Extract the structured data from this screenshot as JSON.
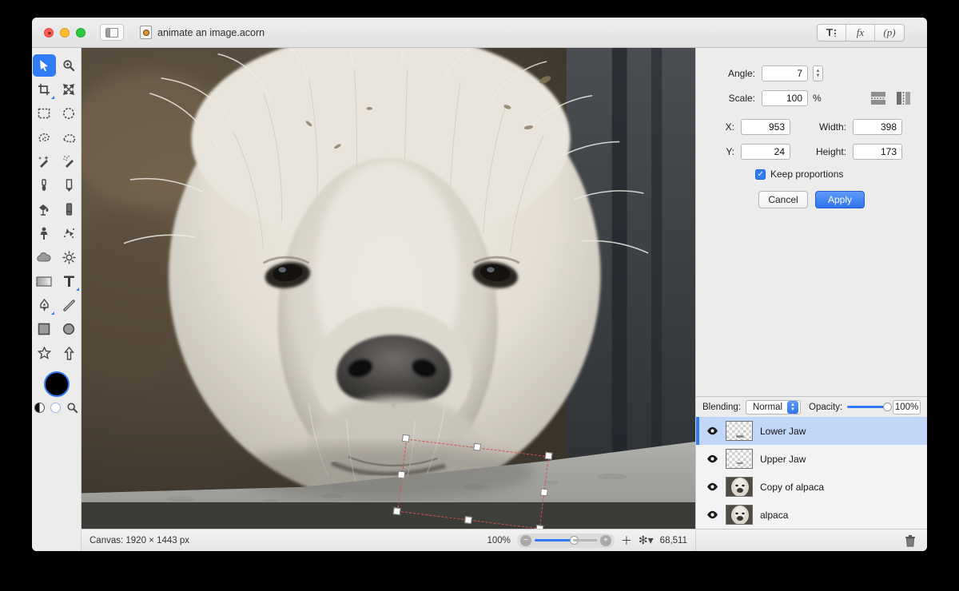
{
  "window": {
    "title": "animate an image.acorn",
    "traffic_lights": [
      "close",
      "minimize",
      "zoom"
    ]
  },
  "toolbar": {
    "sidebar_toggle": "sidebar-toggle",
    "segmented": [
      {
        "id": "transform",
        "label": ""
      },
      {
        "id": "fx",
        "label": "fx"
      },
      {
        "id": "p",
        "label": "(p)"
      }
    ]
  },
  "tools": [
    {
      "name": "move-tool",
      "selected": true
    },
    {
      "name": "zoom-tool",
      "selected": false
    },
    {
      "name": "crop-tool",
      "selected": false
    },
    {
      "name": "transform-tool",
      "selected": false
    },
    {
      "name": "rectangular-select-tool",
      "selected": false
    },
    {
      "name": "elliptical-select-tool",
      "selected": false
    },
    {
      "name": "lasso-tool",
      "selected": false
    },
    {
      "name": "polygon-lasso-tool",
      "selected": false
    },
    {
      "name": "magic-wand-tool",
      "selected": false
    },
    {
      "name": "instant-alpha-tool",
      "selected": false
    },
    {
      "name": "brush-tool",
      "selected": false
    },
    {
      "name": "pencil-tool",
      "selected": false
    },
    {
      "name": "paint-bucket-tool",
      "selected": false
    },
    {
      "name": "eraser-tool",
      "selected": false
    },
    {
      "name": "clone-stamp-tool",
      "selected": false
    },
    {
      "name": "smudge-tool",
      "selected": false
    },
    {
      "name": "blur-tool",
      "selected": false
    },
    {
      "name": "dodge-tool",
      "selected": false
    },
    {
      "name": "gradient-tool",
      "selected": false
    },
    {
      "name": "text-tool",
      "selected": false
    },
    {
      "name": "bezier-pen-tool",
      "selected": false
    },
    {
      "name": "line-tool",
      "selected": false
    },
    {
      "name": "rectangle-shape-tool",
      "selected": false
    },
    {
      "name": "ellipse-shape-tool",
      "selected": false
    },
    {
      "name": "star-shape-tool",
      "selected": false
    },
    {
      "name": "arrow-shape-tool",
      "selected": false
    }
  ],
  "transform_panel": {
    "angle_label": "Angle:",
    "angle_value": "7",
    "scale_label": "Scale:",
    "scale_value": "100",
    "scale_unit": "%",
    "x_label": "X:",
    "x_value": "953",
    "y_label": "Y:",
    "y_value": "24",
    "width_label": "Width:",
    "width_value": "398",
    "height_label": "Height:",
    "height_value": "173",
    "keep_proportions_label": "Keep proportions",
    "keep_proportions_checked": true,
    "flip_horizontal": "flip-horizontal",
    "flip_vertical": "flip-vertical",
    "cancel_label": "Cancel",
    "apply_label": "Apply"
  },
  "layers_panel": {
    "blending_label": "Blending:",
    "blending_value": "Normal",
    "opacity_label": "Opacity:",
    "opacity_value": "100%",
    "layers": [
      {
        "name": "Lower Jaw",
        "thumb": "transparent",
        "visible": true,
        "selected": true
      },
      {
        "name": "Upper Jaw",
        "thumb": "transparent",
        "visible": true,
        "selected": false
      },
      {
        "name": "Copy of alpaca",
        "thumb": "photo",
        "visible": true,
        "selected": false
      },
      {
        "name": "alpaca",
        "thumb": "photo",
        "visible": true,
        "selected": false
      }
    ],
    "delete_icon": "trash-icon"
  },
  "statusbar": {
    "canvas_info": "Canvas: 1920 × 1443 px",
    "zoom_level": "100%",
    "add_icon": "plus-icon",
    "settings_icon": "gear-icon",
    "memory_value": "68,511"
  },
  "canvas": {
    "image_subject": "alpaca",
    "selection": {
      "angle_deg": 7,
      "handles": 8
    }
  },
  "colors": {
    "accent": "#2f7cf6",
    "chrome": "#ececec",
    "selection_row": "#c2d6f7",
    "apply_button": "#2f72ed",
    "selection_border": "#d94f4f"
  }
}
